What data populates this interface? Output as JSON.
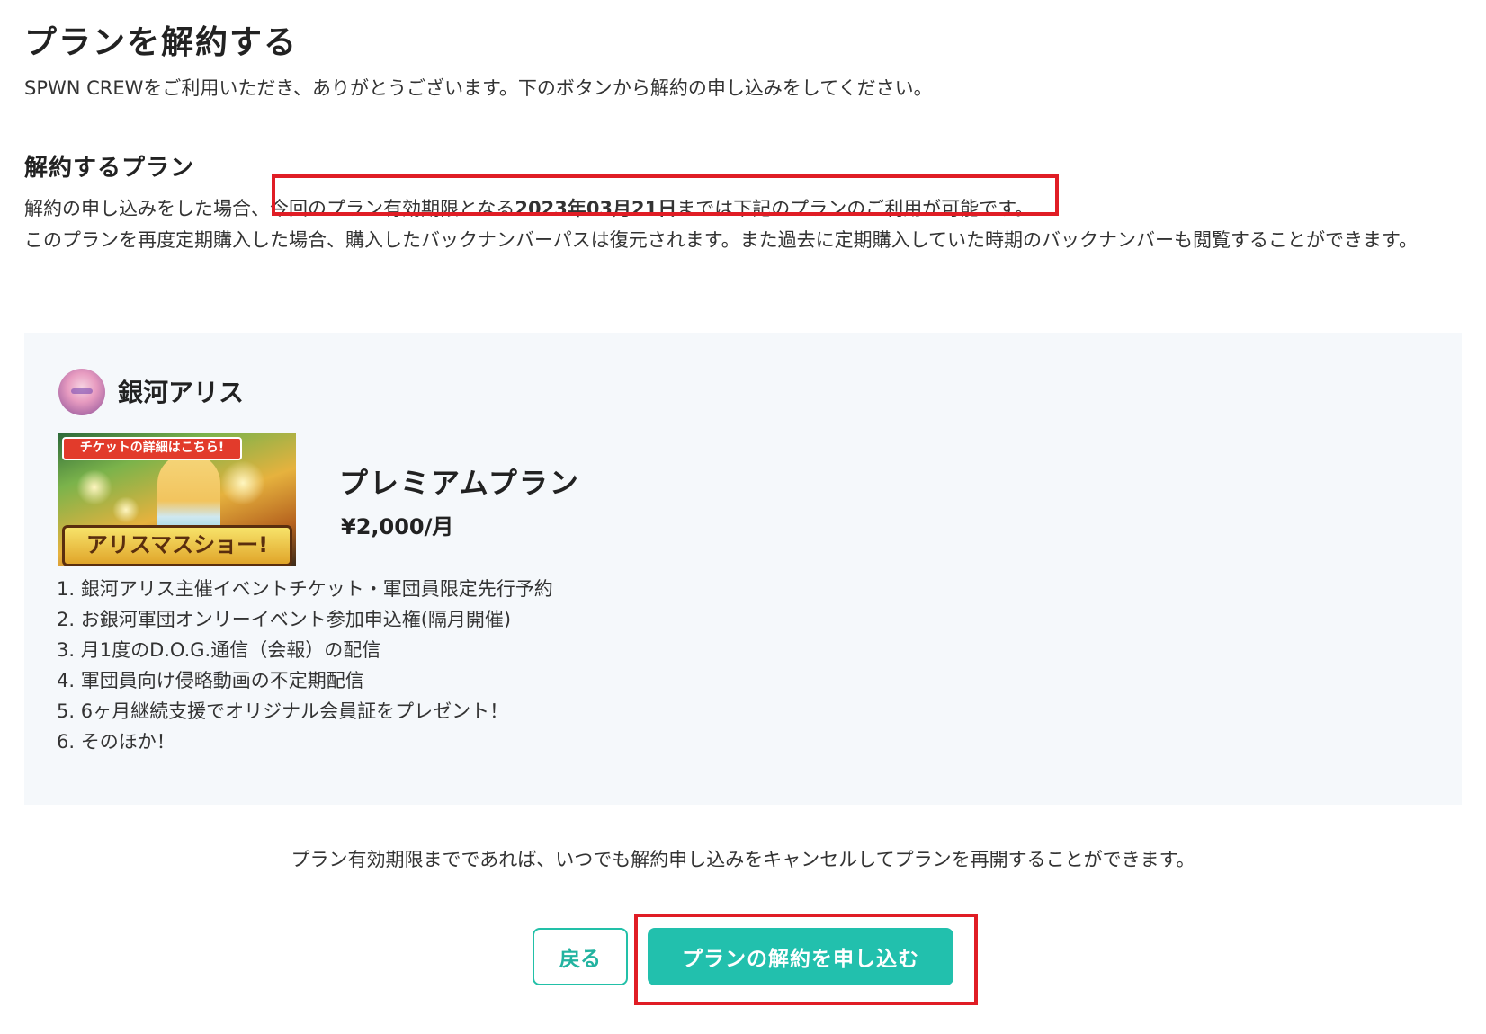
{
  "page": {
    "title": "プランを解約する",
    "intro": "SPWN CREWをご利用いただき、ありがとうございます。下のボタンから解約の申し込みをしてください。"
  },
  "section": {
    "title": "解約するプラン",
    "notice_prefix": "解約の申し込みをした場合、",
    "notice_highlight_start": "今回のプラン有効期限となる",
    "notice_date": "2023年03月21日",
    "notice_highlight_end": "までは下記のプランのご利用が可能です。",
    "notice_line2": "このプランを再度定期購入した場合、購入したバックナンバーパスは復元されます。また過去に定期購入していた時期のバックナンバーも閲覧することができます。"
  },
  "plan": {
    "creator_name": "銀河アリス",
    "thumbnail_banner_top": "チケットの詳細はこちら!",
    "thumbnail_banner_bottom": "アリスマスショー!",
    "name": "プレミアムプラン",
    "price": "¥2,000/月",
    "benefits": [
      "1. 銀河アリス主催イベントチケット・軍団員限定先行予約",
      "2. お銀河軍団オンリーイベント参加申込権(隔月開催)",
      "3. 月1度のD.O.G.通信（会報）の配信",
      "4. 軍団員向け侵略動画の不定期配信",
      "5. 6ヶ月継続支援でオリジナル会員証をプレゼント！",
      "6. そのほか！"
    ]
  },
  "footer": {
    "note": "プラン有効期限までであれば、いつでも解約申し込みをキャンセルしてプランを再開することができます。",
    "back_label": "戻る",
    "cancel_label": "プランの解約を申し込む"
  },
  "colors": {
    "accent": "#22c0ad",
    "highlight_border": "#e01d25",
    "card_background": "#f5f8fb"
  }
}
